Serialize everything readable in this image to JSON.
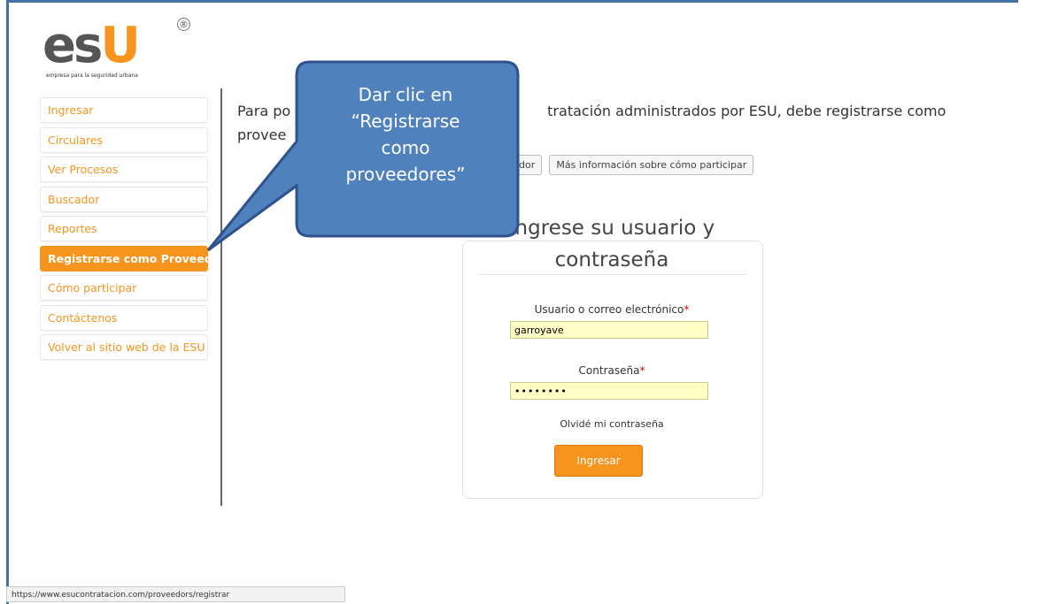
{
  "logo": {
    "text_main": "es",
    "text_accent": "U",
    "registered": "®",
    "tagline": "empresa para la seguridad urbana"
  },
  "sidebar": {
    "items": [
      {
        "label": "Ingresar"
      },
      {
        "label": "Circulares"
      },
      {
        "label": "Ver Procesos"
      },
      {
        "label": "Buscador"
      },
      {
        "label": "Reportes"
      },
      {
        "label": "Registrarse como Proveedor",
        "active": true
      },
      {
        "label": "Cómo participar"
      },
      {
        "label": "Contáctenos"
      },
      {
        "label": "Volver al sitio web de la ESU"
      }
    ]
  },
  "main": {
    "intro_line1_start": "Para po",
    "intro_line1_end": "tratación administrados por ESU, debe registrarse como",
    "intro_line2": "provee",
    "buttons": {
      "register": "proveedor",
      "more_info": "Más información sobre cómo participar"
    }
  },
  "login": {
    "title": "Ingrese su usuario y contraseña",
    "user_label": "Usuario o correo electrónico",
    "user_value": "garroyave",
    "password_label": "Contraseña",
    "password_value": "••••••••",
    "required_mark": "*",
    "forgot": "Olvidé mi contraseña",
    "submit": "Ingresar"
  },
  "callout": {
    "line1": "Dar clic en",
    "line2": "“Registrarse",
    "line3": "como",
    "line4": "proveedores”"
  },
  "status_bar": {
    "url": "https://www.esucontratacion.com/proveedors/registrar"
  },
  "colors": {
    "accent": "#f7941d",
    "callout_fill": "#4f81bd",
    "callout_border": "#2f528f",
    "field_bg": "#ffffc6"
  }
}
